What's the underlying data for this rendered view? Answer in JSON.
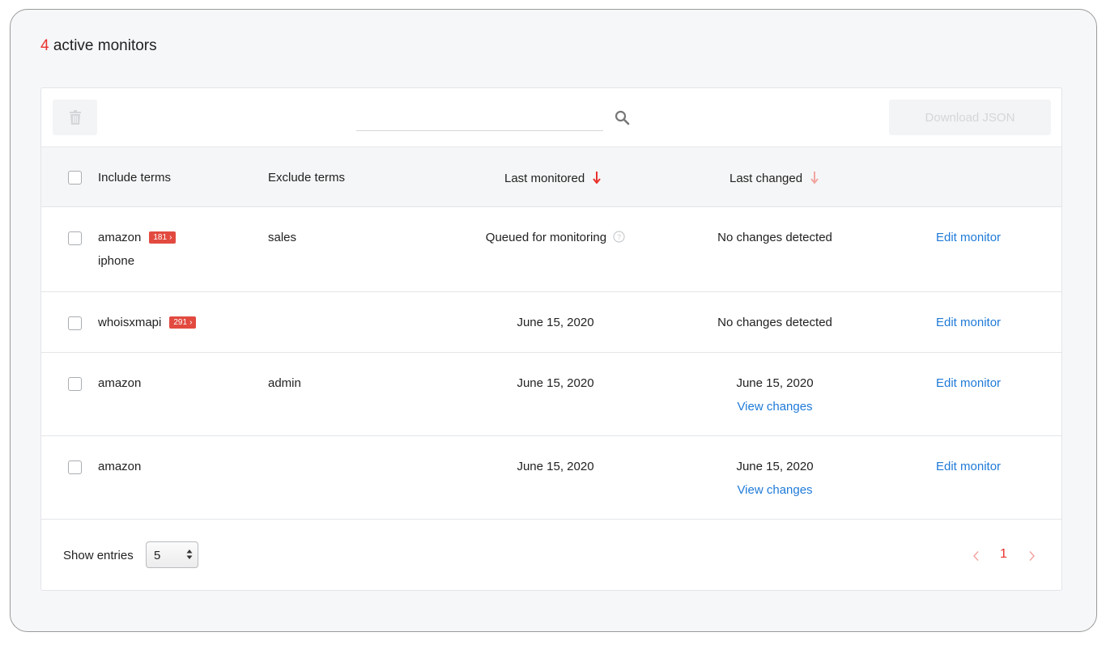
{
  "header": {
    "count": "4",
    "label": " active monitors"
  },
  "toolbar": {
    "delete_icon": "trash-icon",
    "search": {
      "value": "",
      "placeholder": "",
      "icon": "search-icon"
    },
    "download_label": "Download JSON"
  },
  "table": {
    "columns": {
      "include": "Include terms",
      "exclude": "Exclude terms",
      "last_monitored": "Last monitored",
      "last_changed": "Last changed"
    },
    "rows": [
      {
        "include": [
          "amazon",
          "iphone"
        ],
        "badge": "181",
        "exclude": "sales",
        "last_monitored": "Queued for monitoring",
        "last_changed": "No changes detected",
        "view_changes": "",
        "action": "Edit monitor"
      },
      {
        "include": [
          "whoisxmapi"
        ],
        "badge": "291",
        "exclude": "",
        "last_monitored": "June 15, 2020",
        "last_changed": "No changes detected",
        "view_changes": "",
        "action": "Edit monitor"
      },
      {
        "include": [
          "amazon"
        ],
        "badge": "",
        "exclude": "admin",
        "last_monitored": "June 15, 2020",
        "last_changed": "June 15, 2020",
        "view_changes": "View changes",
        "action": "Edit monitor"
      },
      {
        "include": [
          "amazon"
        ],
        "badge": "",
        "exclude": "",
        "last_monitored": "June 15, 2020",
        "last_changed": "June 15, 2020",
        "view_changes": "View changes",
        "action": "Edit monitor"
      }
    ]
  },
  "footer": {
    "show_entries_label": "Show entries",
    "entries_value": "5",
    "current_page": "1"
  },
  "colors": {
    "accent_red": "#e8322d",
    "badge_red": "#e24a40",
    "link_blue": "#1f7ad8"
  }
}
